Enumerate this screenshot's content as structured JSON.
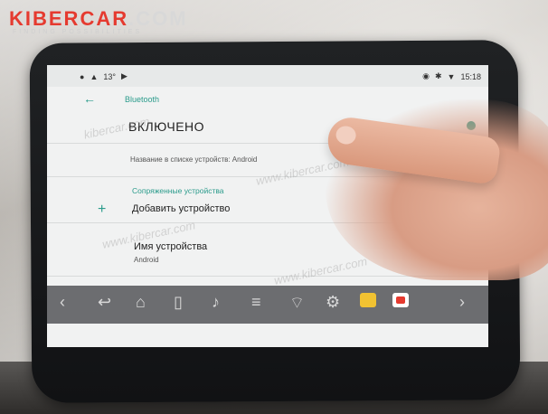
{
  "logo": {
    "main": "KIBERCAR",
    "com": ".COM",
    "sub": "FINDING POSSIBILITIES"
  },
  "status": {
    "temp": "13°",
    "time": "15:18"
  },
  "appbar": {
    "title": "Bluetooth"
  },
  "bluetooth": {
    "enabled_label": "ВКЛЮЧЕНО",
    "device_list_name": "Название в списке устройств: Android",
    "paired_section": "Сопряженные устройства",
    "add_device": "Добавить устройство",
    "device_name_title": "Имя устройства",
    "device_name_value": "Android"
  },
  "watermarks": [
    "kibercar.com",
    "www.kibercar.com",
    "www.kibercar.com",
    "www.kibercar.com"
  ],
  "colors": {
    "accent": "#2a9b8b",
    "brand_red": "#e53a2f"
  }
}
